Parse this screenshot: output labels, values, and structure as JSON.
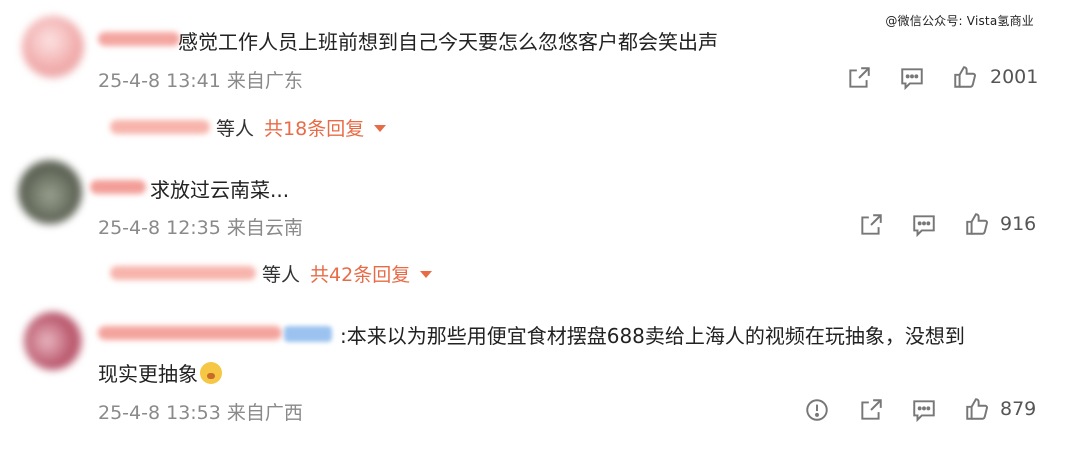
{
  "watermark": "@微信公众号: Vista氢商业",
  "comments": [
    {
      "text": "感觉工作人员上班前想到自己今天要怎么忽悠客户都会笑出声",
      "meta": "25-4-8 13:41 来自广东",
      "likes": "2001",
      "reply_who": "等人",
      "reply_total": "共18条回复",
      "avatar_color": "#f2b9b9"
    },
    {
      "text": "求放过云南菜...",
      "meta": "25-4-8 12:35 来自云南",
      "likes": "916",
      "reply_who": "等人",
      "reply_total": "共42条回复",
      "avatar_color": "#6f7468"
    },
    {
      "text_line1": ":本来以为那些用便宜食材摆盘688卖给上海人的视频在玩抽象，没想到",
      "text_line2": "现实更抽象",
      "meta": "25-4-8 13:53 来自广西",
      "likes": "879",
      "avatar_color": "#c97a88"
    }
  ],
  "icons": {
    "share": "share-icon",
    "comment": "comment-icon",
    "like": "thumbs-up-icon",
    "report": "report-icon",
    "emoji": "shocked-emoji-icon"
  },
  "colors": {
    "accent": "#e86b47",
    "meta": "#8a8a8a"
  }
}
